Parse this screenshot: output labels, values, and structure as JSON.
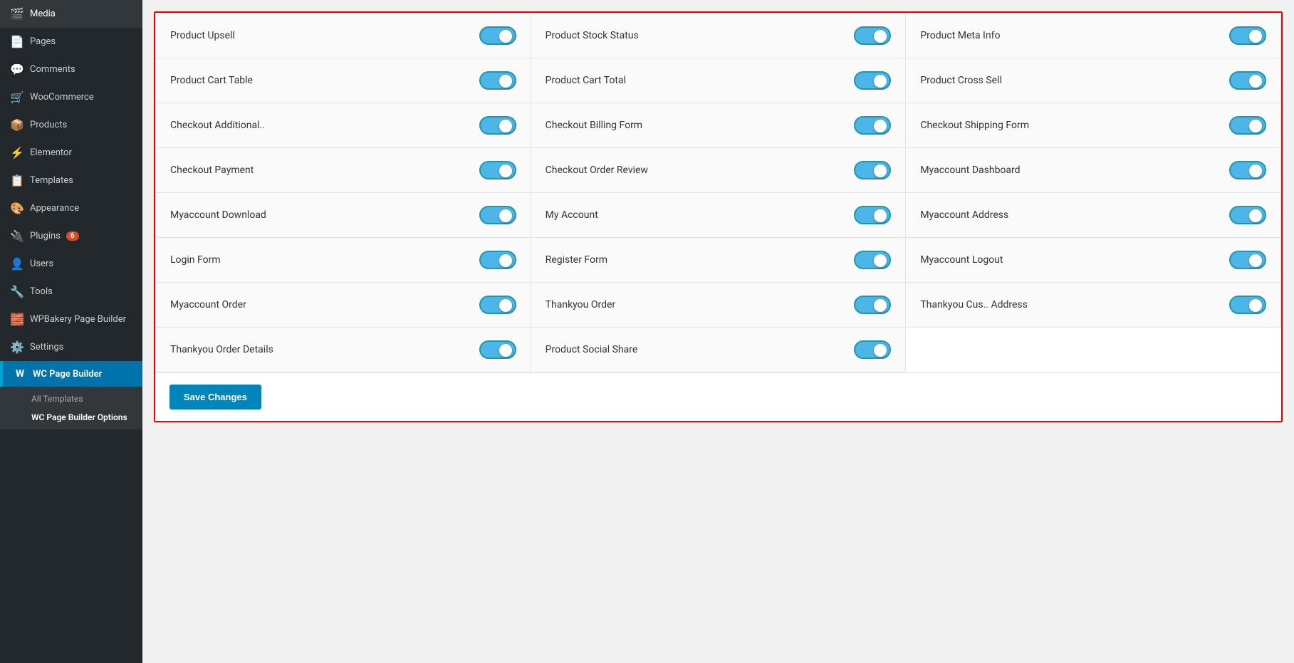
{
  "sidebar": {
    "items": [
      {
        "id": "media",
        "label": "Media",
        "icon": "🎬"
      },
      {
        "id": "pages",
        "label": "Pages",
        "icon": "📄"
      },
      {
        "id": "comments",
        "label": "Comments",
        "icon": "💬"
      },
      {
        "id": "woocommerce",
        "label": "WooCommerce",
        "icon": "🛒"
      },
      {
        "id": "products",
        "label": "Products",
        "icon": "📦"
      },
      {
        "id": "elementor",
        "label": "Elementor",
        "icon": "⚡"
      },
      {
        "id": "templates",
        "label": "Templates",
        "icon": "📋"
      },
      {
        "id": "appearance",
        "label": "Appearance",
        "icon": "🎨"
      },
      {
        "id": "plugins",
        "label": "Plugins",
        "icon": "🔌",
        "badge": "6"
      },
      {
        "id": "users",
        "label": "Users",
        "icon": "👤"
      },
      {
        "id": "tools",
        "label": "Tools",
        "icon": "🔧"
      },
      {
        "id": "wpbakery",
        "label": "WPBakery Page Builder",
        "icon": "🧱"
      },
      {
        "id": "settings",
        "label": "Settings",
        "icon": "⚙️"
      },
      {
        "id": "wcpagebuilder",
        "label": "WC Page Builder",
        "icon": "W",
        "active": true
      }
    ],
    "submenu": [
      {
        "id": "all-templates",
        "label": "All Templates"
      },
      {
        "id": "wc-options",
        "label": "WC Page Builder Options",
        "active": true
      }
    ]
  },
  "toggleItems": [
    {
      "id": "product-upsell",
      "label": "Product Upsell",
      "enabled": true
    },
    {
      "id": "product-stock-status",
      "label": "Product Stock Status",
      "enabled": true
    },
    {
      "id": "product-meta-info",
      "label": "Product Meta Info",
      "enabled": true
    },
    {
      "id": "product-cart-table",
      "label": "Product Cart Table",
      "enabled": true
    },
    {
      "id": "product-cart-total",
      "label": "Product Cart Total",
      "enabled": true
    },
    {
      "id": "product-cross-sell",
      "label": "Product Cross Sell",
      "enabled": true
    },
    {
      "id": "checkout-additional",
      "label": "Checkout Additional..",
      "enabled": true
    },
    {
      "id": "checkout-billing-form",
      "label": "Checkout Billing Form",
      "enabled": true
    },
    {
      "id": "checkout-shipping-form",
      "label": "Checkout Shipping Form",
      "enabled": true
    },
    {
      "id": "checkout-payment",
      "label": "Checkout Payment",
      "enabled": true
    },
    {
      "id": "checkout-order-review",
      "label": "Checkout Order Review",
      "enabled": true
    },
    {
      "id": "myaccount-dashboard",
      "label": "Myaccount Dashboard",
      "enabled": true
    },
    {
      "id": "myaccount-download",
      "label": "Myaccount Download",
      "enabled": true
    },
    {
      "id": "my-account",
      "label": "My Account",
      "enabled": true
    },
    {
      "id": "myaccount-address",
      "label": "Myaccount Address",
      "enabled": true
    },
    {
      "id": "login-form",
      "label": "Login Form",
      "enabled": true
    },
    {
      "id": "register-form",
      "label": "Register Form",
      "enabled": true
    },
    {
      "id": "myaccount-logout",
      "label": "Myaccount Logout",
      "enabled": true
    },
    {
      "id": "myaccount-order",
      "label": "Myaccount Order",
      "enabled": true
    },
    {
      "id": "thankyou-order",
      "label": "Thankyou Order",
      "enabled": true
    },
    {
      "id": "thankyou-cus-address",
      "label": "Thankyou Cus.. Address",
      "enabled": true
    },
    {
      "id": "thankyou-order-details",
      "label": "Thankyou Order Details",
      "enabled": true
    },
    {
      "id": "product-social-share",
      "label": "Product Social Share",
      "enabled": true
    }
  ],
  "saveButton": {
    "label": "Save Changes"
  }
}
